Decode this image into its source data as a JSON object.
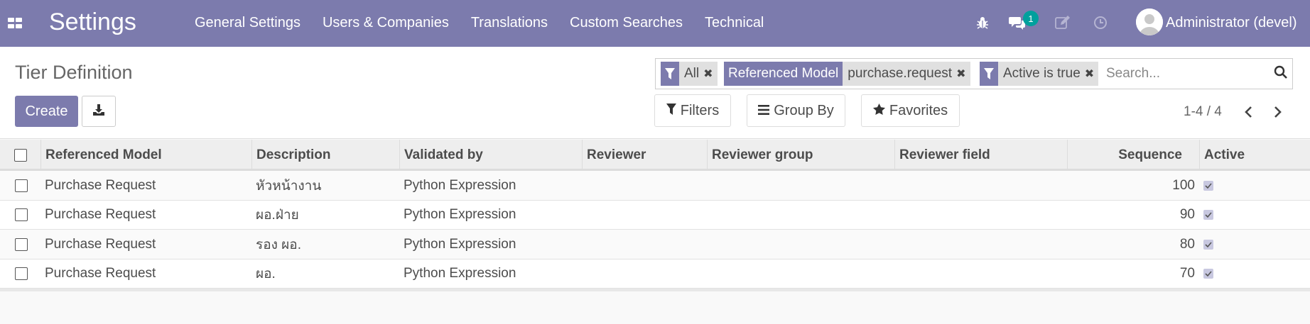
{
  "topbar": {
    "app_title": "Settings",
    "menu": [
      "General Settings",
      "Users & Companies",
      "Translations",
      "Custom Searches",
      "Technical"
    ],
    "messages_badge": "1",
    "user_name": "Administrator (devel)"
  },
  "control_panel": {
    "page_title": "Tier Definition",
    "create_label": "Create",
    "facets": [
      {
        "label": "",
        "value": "All"
      },
      {
        "label": "Referenced Model",
        "value": "purchase.request"
      },
      {
        "label": "",
        "value": "Active is true"
      }
    ],
    "search_placeholder": "Search...",
    "filters_label": "Filters",
    "groupby_label": "Group By",
    "favorites_label": "Favorites",
    "pager": "1-4 / 4"
  },
  "table": {
    "columns": [
      "Referenced Model",
      "Description",
      "Validated by",
      "Reviewer",
      "Reviewer group",
      "Reviewer field",
      "Sequence",
      "Active"
    ],
    "rows": [
      {
        "model": "Purchase Request",
        "description": "หัวหน้างาน",
        "validated_by": "Python Expression",
        "reviewer": "",
        "reviewer_group": "",
        "reviewer_field": "",
        "sequence": "100",
        "active": true
      },
      {
        "model": "Purchase Request",
        "description": "ผอ.ฝ่าย",
        "validated_by": "Python Expression",
        "reviewer": "",
        "reviewer_group": "",
        "reviewer_field": "",
        "sequence": "90",
        "active": true
      },
      {
        "model": "Purchase Request",
        "description": "รอง ผอ.",
        "validated_by": "Python Expression",
        "reviewer": "",
        "reviewer_group": "",
        "reviewer_field": "",
        "sequence": "80",
        "active": true
      },
      {
        "model": "Purchase Request",
        "description": "ผอ.",
        "validated_by": "Python Expression",
        "reviewer": "",
        "reviewer_group": "",
        "reviewer_field": "",
        "sequence": "70",
        "active": true
      }
    ]
  },
  "colors": {
    "brand": "#7c7bad",
    "badge": "#00a09d"
  }
}
